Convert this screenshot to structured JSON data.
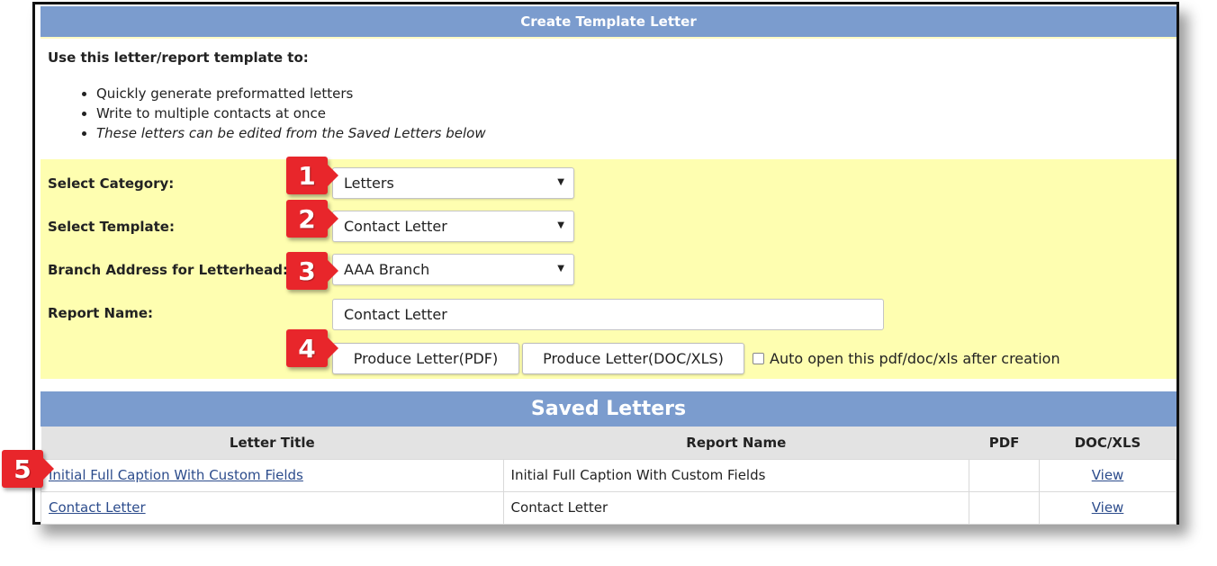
{
  "header": {
    "title": "Create Template Letter"
  },
  "intro": {
    "heading": "Use this letter/report template to:",
    "bullets": [
      "Quickly generate preformatted letters",
      "Write to multiple contacts at once",
      "These letters can be edited from the Saved Letters below"
    ]
  },
  "form": {
    "category_label": "Select Category:",
    "category_value": "Letters",
    "template_label": "Select Template:",
    "template_value": "Contact Letter",
    "branch_label": "Branch Address for Letterhead:",
    "branch_value": "AAA Branch",
    "report_name_label": "Report Name:",
    "report_name_value": "Contact Letter",
    "produce_pdf_label": "Produce Letter(PDF)",
    "produce_doc_label": "Produce Letter(DOC/XLS)",
    "auto_open_label": "Auto open this pdf/doc/xls after creation",
    "auto_open_checked": false
  },
  "saved": {
    "title": "Saved Letters",
    "columns": [
      "Letter Title",
      "Report Name",
      "PDF",
      "DOC/XLS"
    ],
    "rows": [
      {
        "title": "Initial Full Caption With Custom Fields",
        "report_name": "Initial Full Caption With Custom Fields",
        "pdf": "",
        "doc": "View"
      },
      {
        "title": "Contact Letter",
        "report_name": "Contact Letter",
        "pdf": "",
        "doc": "View"
      }
    ]
  },
  "callouts": [
    "1",
    "2",
    "3",
    "4",
    "5"
  ],
  "colors": {
    "header_blue": "#7b9cce",
    "form_yellow": "#fefeb0",
    "callout_red": "#e8262b",
    "link_blue": "#2c4c8c"
  }
}
